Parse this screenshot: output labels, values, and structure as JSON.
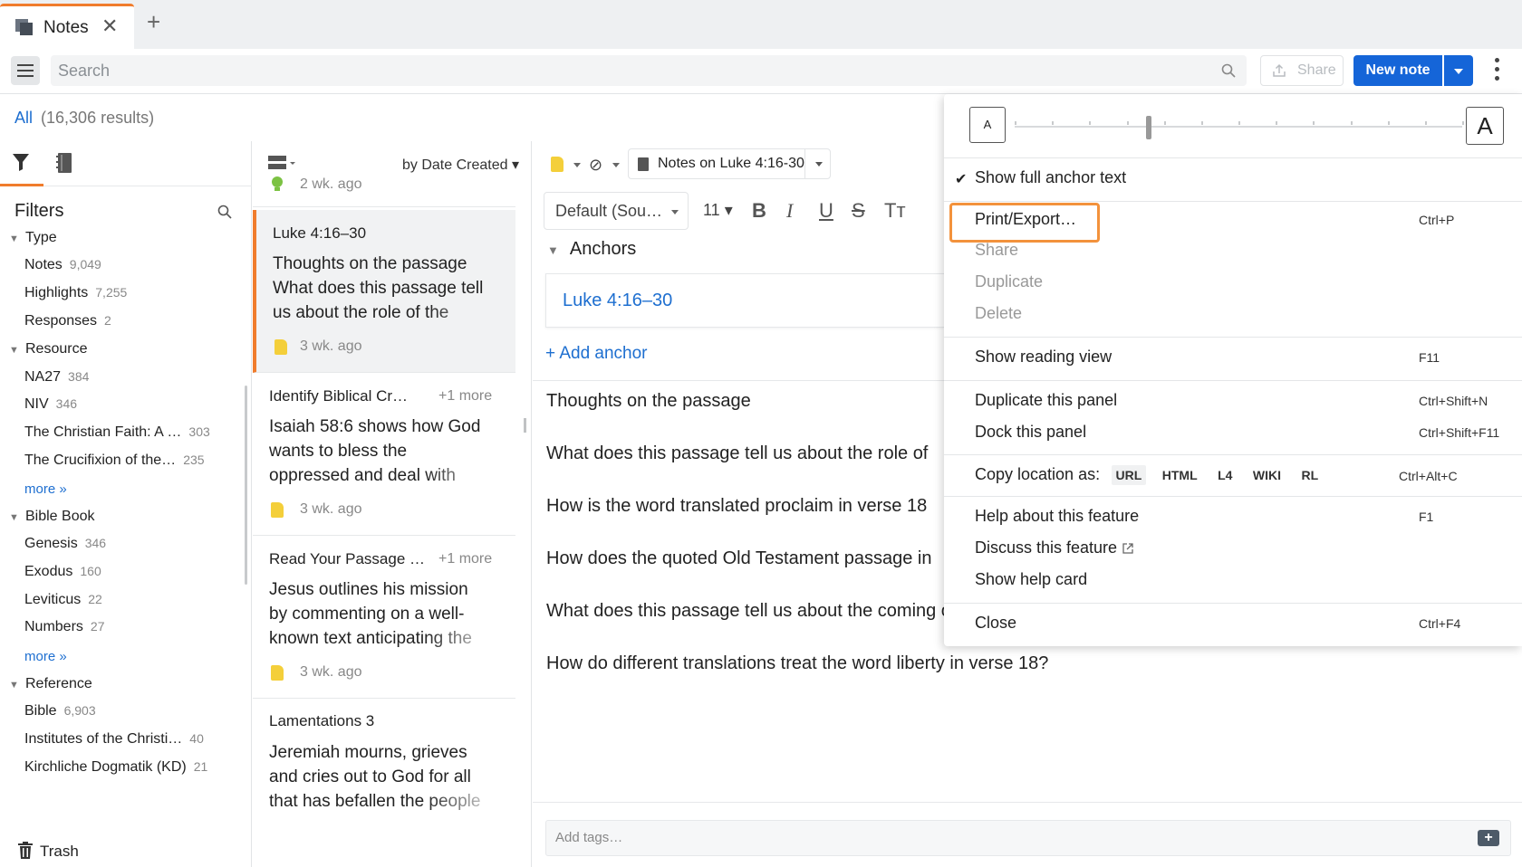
{
  "tab": {
    "title": "Notes",
    "close": "✕",
    "new_tab": "+"
  },
  "toolbar": {
    "search_placeholder": "Search",
    "share": "Share",
    "new_note": "New note"
  },
  "results": {
    "scope": "All",
    "count": "(16,306 results)"
  },
  "filters": {
    "title": "Filters",
    "groups": [
      {
        "label": "Type",
        "items": [
          {
            "label": "Notes",
            "count": "9,049"
          },
          {
            "label": "Highlights",
            "count": "7,255"
          },
          {
            "label": "Responses",
            "count": "2"
          }
        ]
      },
      {
        "label": "Resource",
        "items": [
          {
            "label": "NA27",
            "count": "384"
          },
          {
            "label": "NIV",
            "count": "346"
          },
          {
            "label": "The Christian Faith: A …",
            "count": "303"
          },
          {
            "label": "The Crucifixion of the…",
            "count": "235"
          }
        ],
        "more": "more »"
      },
      {
        "label": "Bible Book",
        "items": [
          {
            "label": "Genesis",
            "count": "346"
          },
          {
            "label": "Exodus",
            "count": "160"
          },
          {
            "label": "Leviticus",
            "count": "22"
          },
          {
            "label": "Numbers",
            "count": "27"
          }
        ],
        "more": "more »"
      },
      {
        "label": "Reference",
        "items": [
          {
            "label": "Bible",
            "count": "6,903"
          },
          {
            "label": "Institutes of the Christi…",
            "count": "40"
          },
          {
            "label": "Kirchliche Dogmatik (KD)",
            "count": "21"
          }
        ]
      }
    ],
    "trash": "Trash"
  },
  "list": {
    "sort": "by Date Created",
    "top_date": "2 wk. ago",
    "notes": [
      {
        "title": "Luke 4:16–30",
        "more": "",
        "body": [
          "Thoughts on the passage",
          "What does this passage tell",
          "us about the role of the"
        ],
        "date": "3 wk. ago"
      },
      {
        "title": "Identify Biblical Cr…",
        "more": "+1 more",
        "body": [
          "Isaiah 58:6 shows how God",
          "wants to bless the",
          "oppressed and deal with"
        ],
        "date": "3 wk. ago"
      },
      {
        "title": "Read Your Passage …",
        "more": "+1 more",
        "body": [
          "Jesus outlines his mission",
          "by commenting on a well-",
          "known text anticipating the"
        ],
        "date": "3 wk. ago"
      },
      {
        "title": "Lamentations 3",
        "more": "",
        "body": [
          "Jeremiah mourns, grieves",
          "and cries out to God for all",
          "that has befallen the people"
        ],
        "date": ""
      }
    ]
  },
  "editor": {
    "notebook": "Notes on Luke 4:16-30",
    "font": "Default (Sou…",
    "size": "11",
    "anchors_title": "Anchors",
    "anchor": "Luke 4:16–30",
    "add_anchor": "+ Add anchor",
    "lines": [
      "Thoughts on the passage",
      "What does this passage tell us about the role of",
      "How is the word translated proclaim in verse 18",
      "How does the quoted Old Testament passage in",
      "What does this passage tell us about the coming of the Messiah?",
      "How do different translations treat the word liberty in verse 18?"
    ],
    "tags_placeholder": "Add tags…"
  },
  "menu": {
    "font_small": "A",
    "font_large": "A",
    "font_size_level": 0.3,
    "show_anchor": "Show full anchor text",
    "print": "Print/Export…",
    "print_key": "Ctrl+P",
    "share": "Share",
    "duplicate": "Duplicate",
    "delete": "Delete",
    "reading_view": "Show reading view",
    "reading_view_key": "F11",
    "dup_panel": "Duplicate this panel",
    "dup_panel_key": "Ctrl+Shift+N",
    "dock_panel": "Dock this panel",
    "dock_panel_key": "Ctrl+Shift+F11",
    "copy_loc": "Copy location as:",
    "copy_loc_key": "Ctrl+Alt+C",
    "loc_formats": [
      "URL",
      "HTML",
      "L4",
      "WIKI",
      "RL"
    ],
    "help": "Help about this feature",
    "help_key": "F1",
    "discuss": "Discuss this feature",
    "help_card": "Show help card",
    "close": "Close",
    "close_key": "Ctrl+F4"
  }
}
